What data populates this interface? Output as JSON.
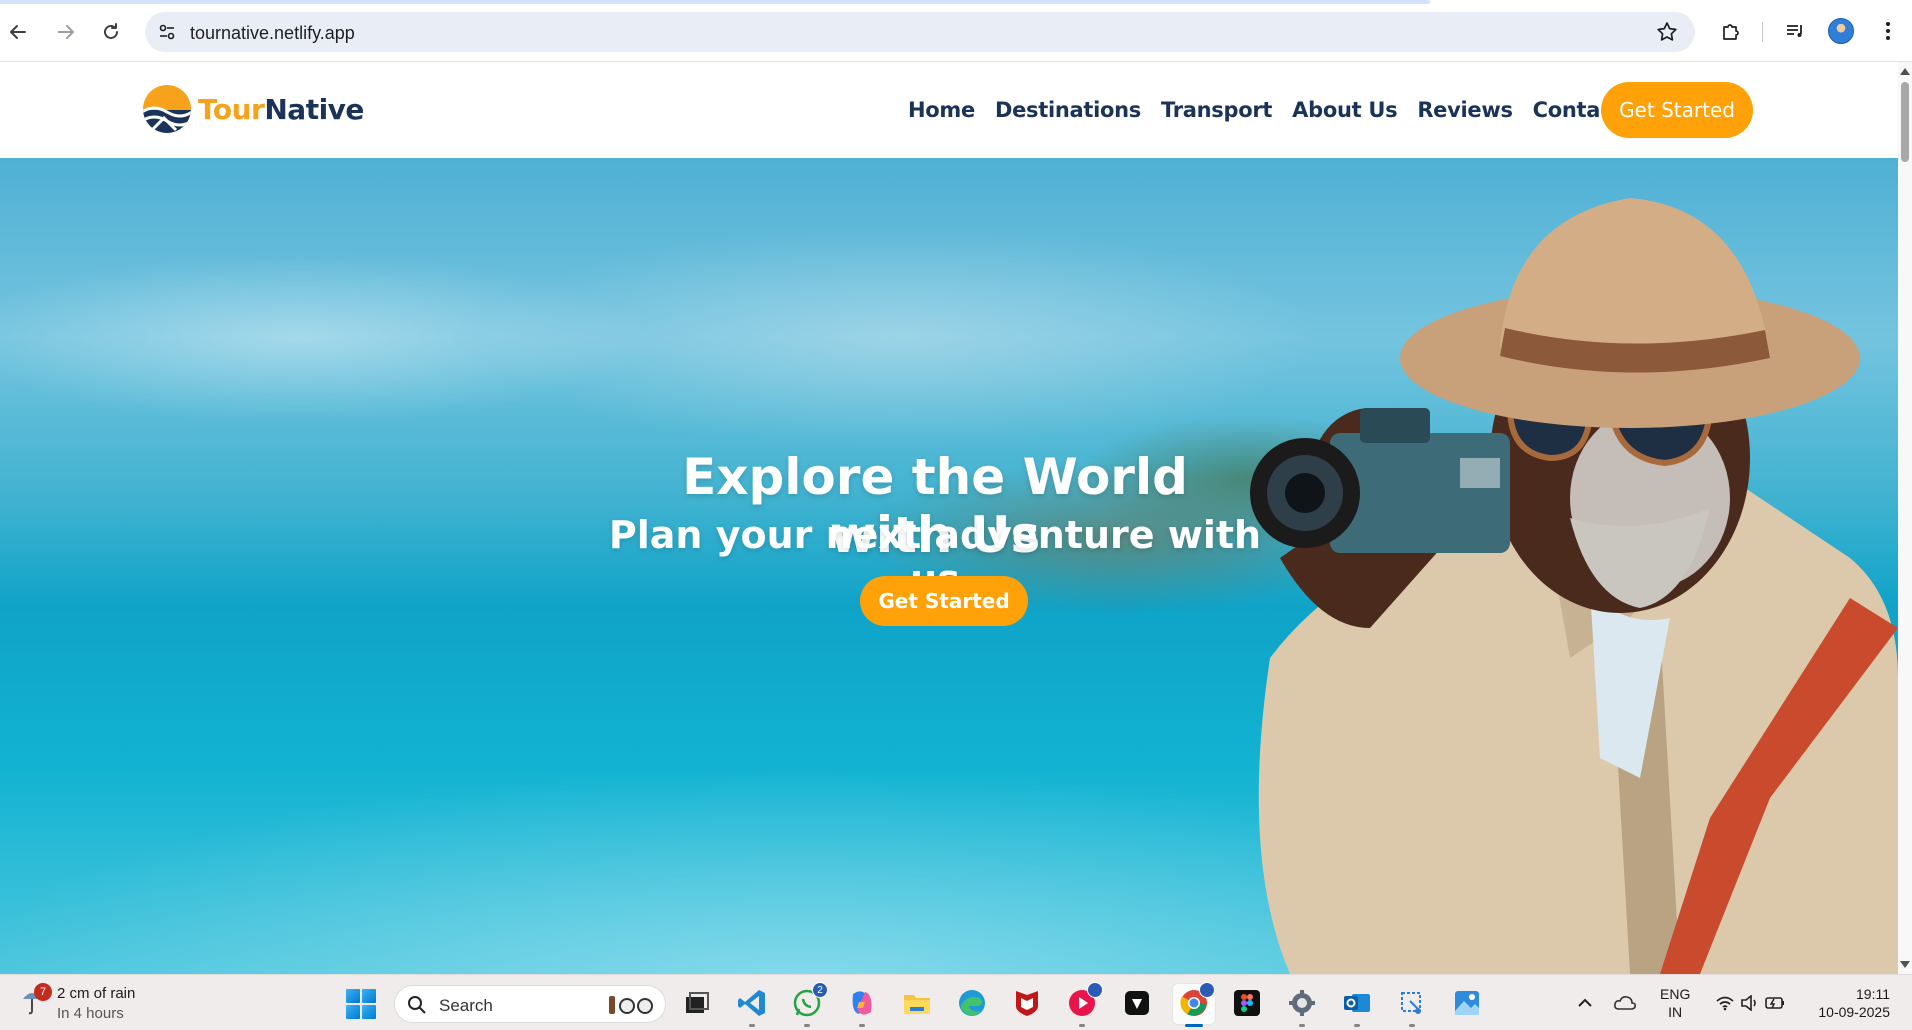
{
  "browser": {
    "url": "tournative.netlify.app"
  },
  "site": {
    "logo_part1": "Tour",
    "logo_part2": "Native",
    "nav": [
      {
        "label": "Home"
      },
      {
        "label": "Destinations"
      },
      {
        "label": "Transport"
      },
      {
        "label": "About Us"
      },
      {
        "label": "Reviews"
      },
      {
        "label": "Contact Us"
      }
    ],
    "header_cta": "Get Started",
    "hero": {
      "title": "Explore the World with Us",
      "subtitle": "Plan your next adventure with us",
      "cta": "Get Started"
    },
    "colors": {
      "accent": "#ffa20a",
      "navy": "#1b3358"
    }
  },
  "taskbar": {
    "weather": {
      "line1": "2 cm of rain",
      "line2": "In 4 hours",
      "badge": "7"
    },
    "search_placeholder": "Search",
    "whatsapp_badge": "2",
    "language_line1": "ENG",
    "language_line2": "IN",
    "time": "19:11",
    "date": "10-09-2025"
  }
}
